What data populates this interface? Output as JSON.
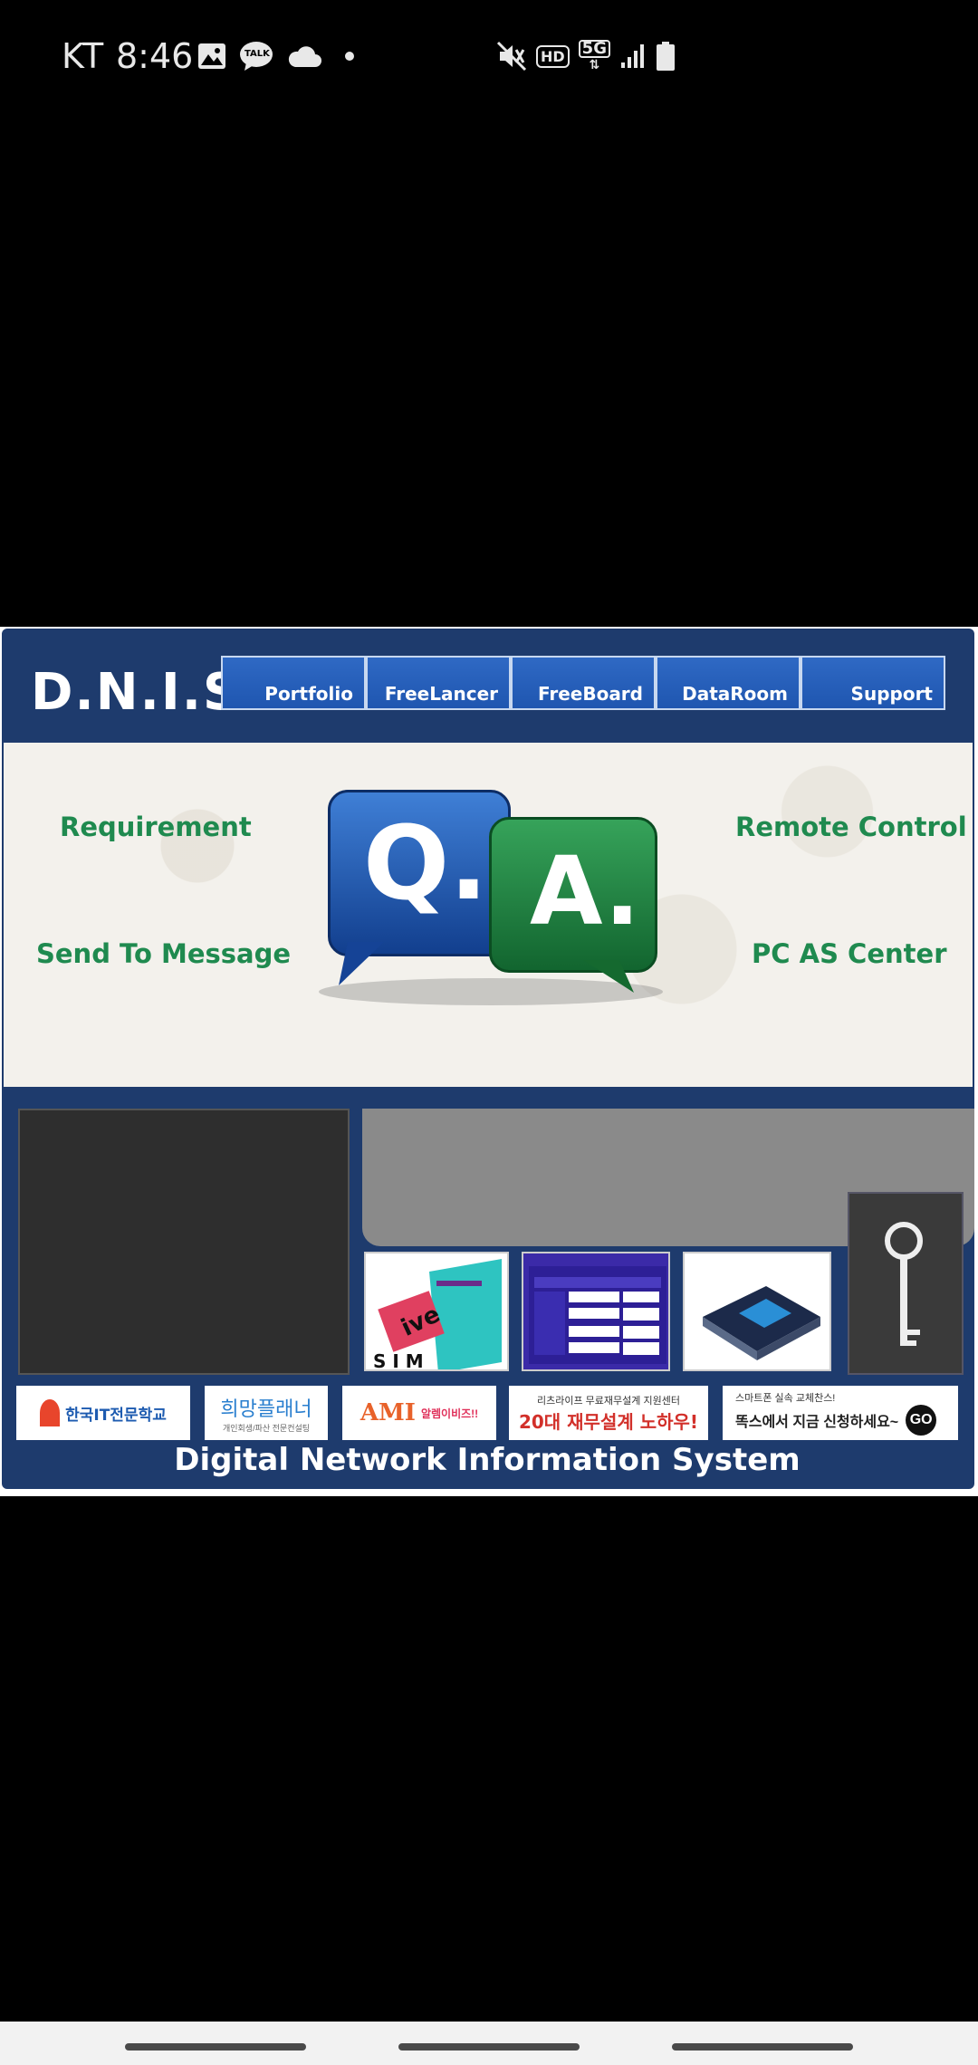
{
  "status_bar": {
    "carrier": "KT",
    "time": "8:46",
    "left_icons": [
      "gallery-icon",
      "kakaotalk-icon",
      "cloud-icon",
      "dot-icon"
    ],
    "talk_badge": "TALK",
    "right_icons": [
      "mute-icon",
      "hd-icon",
      "5g-icon",
      "signal-icon",
      "battery-icon"
    ],
    "hd_label": "HD",
    "network_label": "5G"
  },
  "web": {
    "logo": "D.N.I.S",
    "nav": [
      "Portfolio",
      "FreeLancer",
      "FreeBoard",
      "DataRoom",
      "Support"
    ],
    "qa": {
      "q": "Q.",
      "a": "A.",
      "links": {
        "requirement": "Requirement",
        "send_message": "Send To Message",
        "remote_control": "Remote Control",
        "pc_as_center": "PC AS Center"
      }
    },
    "banners": {
      "b1": "한국IT전문학교",
      "b2": "희망플래너",
      "b2_sub": "개인회생/파산 전문컨설팅",
      "b3_main": "AMI",
      "b3_sub": "알렘이비즈!!",
      "b4_top": "리츠라이프 무료재무설계 지원센터",
      "b4_main": "20대 재무설계 노하우!",
      "b5_top": "스마트폰 실속 교체찬스!",
      "b5_main": "똑스에서 지금 신청하세요~",
      "b5_go": "GO"
    },
    "footer": "Digital Network Information System"
  },
  "colors": {
    "navy": "#1e3b6d",
    "nav_blue": "#2a63c0",
    "q_blue": "#1f4fa0",
    "a_green": "#1d7a3c",
    "link_green": "#1f8a4f"
  }
}
